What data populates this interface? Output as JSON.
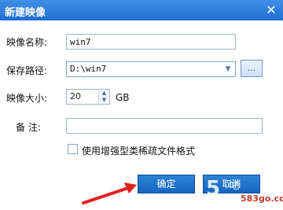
{
  "window": {
    "title": "新建映像",
    "close_icon": "close-icon"
  },
  "form": {
    "image_name_label": "映像名称:",
    "image_name_value": "win7",
    "save_path_label": "保存路径:",
    "save_path_value": "D:\\win7",
    "browse_label": "...",
    "image_size_label": "映像大小:",
    "image_size_value": "20",
    "image_size_unit": "GB",
    "remark_label": "备    注:",
    "remark_value": "",
    "sparse_format_label": "使用增强型类稀疏文件格式",
    "sparse_format_checked": false
  },
  "buttons": {
    "ok_label": "确定",
    "cancel_label": "取消"
  },
  "watermark": {
    "text": "583go.com"
  },
  "colors": {
    "titlebar": "#2a7fe0",
    "button": "#1f6fd3",
    "annotation_arrow": "#e02020"
  }
}
